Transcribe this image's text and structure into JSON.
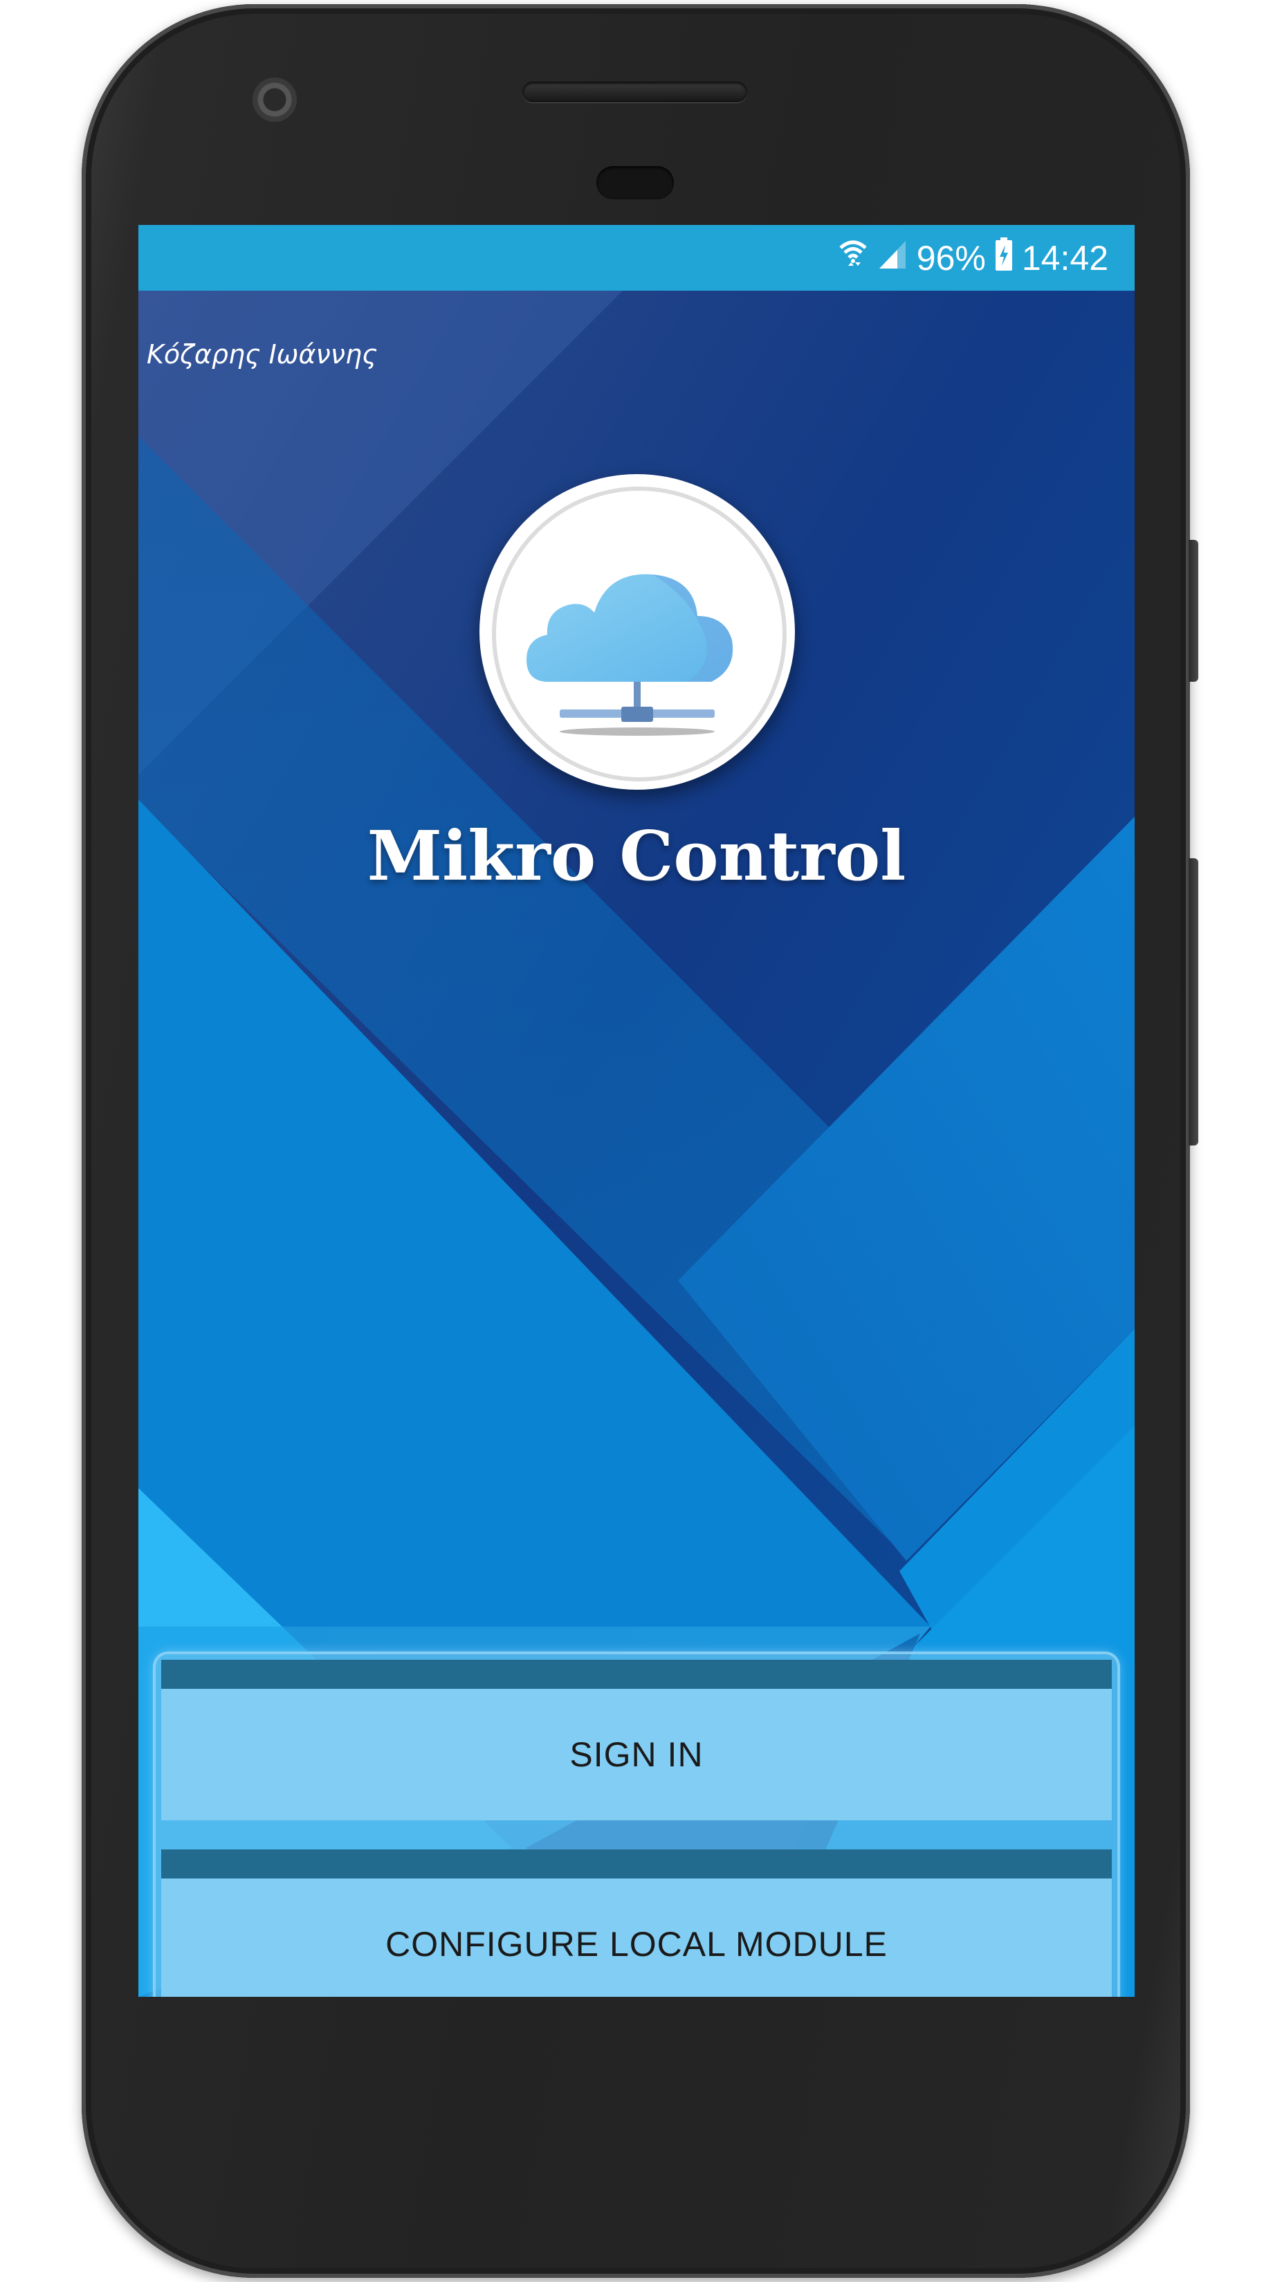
{
  "status_bar": {
    "wifi_icon": "wifi-data-icon",
    "signal_icon": "cell-signal-icon",
    "battery_percent": "96%",
    "battery_icon": "battery-charging-icon",
    "time": "14:42"
  },
  "screen": {
    "author": "Κόζαρης Ιωάννης",
    "logo_icon": "cloud-network-icon",
    "app_title": "Mikro Control"
  },
  "actions": {
    "sign_in": "SIGN IN",
    "configure": "CONFIGURE LOCAL MODULE"
  },
  "colors": {
    "status_bar": "#21a4d6",
    "background_dark": "#0a3a8c",
    "background_light": "#29b6f6",
    "button": "#82cdf3",
    "divider": "#226b8f"
  }
}
